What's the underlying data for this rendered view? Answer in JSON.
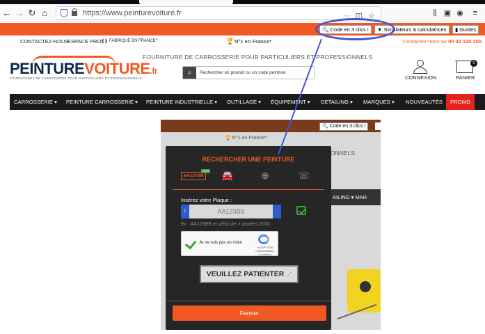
{
  "browser": {
    "url": "https://www.peinturevoiture.fr",
    "page_actions_icon": "more-dots-icon",
    "toolbar_icons": [
      "library-icon",
      "sidebar-icon",
      "account-icon",
      "menu-icon"
    ]
  },
  "topbar": {
    "code_btn": "Code en 3 clics !",
    "simulateurs_btn": "Simulateurs & calculatrices",
    "guides_btn": "Guides"
  },
  "infobar": {
    "contact": "CONTACTEZ-NOUS",
    "espace_pro": "ESPACE PRO",
    "fabrique": "FABRIQUÉ EN FRANCE*",
    "rank": "N°1 en France*",
    "phone_label": "Contactez-nous au",
    "phone": "05 33 120 100"
  },
  "header": {
    "logo_main": "PEINTURE",
    "logo_accent": "VOITURE",
    "logo_tld": ".fr",
    "logo_tagline": "FOURNITURES DE CARROSSERIE POUR PARTICULIERS ET PROFESSIONNELS",
    "tagline": "FOURNITURE DE CARROSSERIE POUR PARTICULIERS ET PROFESSIONNELS",
    "search_placeholder": "Rechercher un produit ou un code peinture",
    "connexion": "CONNEXION",
    "panier": "PANIER",
    "cart_count": "0"
  },
  "nav": [
    "CARROSSERIE ▾",
    "PEINTURE CARROSSERIE ▾",
    "PEINTURE INDUSTRIELLE ▾",
    "OUTILLAGE ▾",
    "ÉQUIPEMENT ▾",
    "DETAILING ▾",
    "MARQUES ▾",
    "NOUVEAUTÉS",
    "PROMO"
  ],
  "screenshot_bg": {
    "code_btn": "Code en 3 clics !",
    "rank": "N°1 en France*",
    "frag_onnels": "ONNELS",
    "frag_nav": "AILING ▾   MAR"
  },
  "modal": {
    "title": "RECHERCHER UNE PEINTURE",
    "plate_tab": "AA-123-BB",
    "new_badge": "NEW",
    "label": "Insérez votre Plaque :",
    "plate_value": "AA123BB",
    "plate_eu": "F",
    "example": "Ex : AA123BB et véhicule > années 2000",
    "captcha_text": "Je ne suis pas un robot",
    "captcha_brand": "reCAPTCHA",
    "captcha_links": "Confidentialité - Conditions",
    "wait_button": "VEUILLEZ PATIENTER",
    "close_button": "Fermer"
  },
  "colors": {
    "accent": "#f05a22",
    "nav_bg": "#1b1b1b",
    "promo": "#e5231d",
    "annotation": "#4655d1"
  }
}
